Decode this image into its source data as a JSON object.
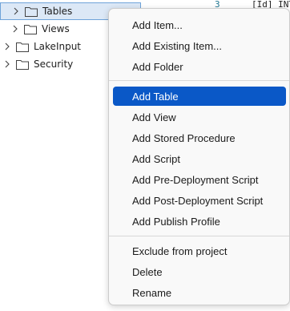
{
  "tree": {
    "items": [
      {
        "label": "Tables",
        "icon": "folder-icon",
        "expand": "chevron-right-icon"
      },
      {
        "label": "Views",
        "icon": "folder-icon",
        "expand": "chevron-right-icon"
      },
      {
        "label": "LakeInput",
        "icon": "folder-icon",
        "expand": "chevron-right-icon"
      },
      {
        "label": "Security",
        "icon": "folder-icon",
        "expand": "chevron-right-icon"
      }
    ]
  },
  "editor": {
    "line_number": "3",
    "code": "[Id] INT"
  },
  "context_menu": {
    "items": [
      "Add Item...",
      "Add Existing Item...",
      "Add Folder",
      "Add Table",
      "Add View",
      "Add Stored Procedure",
      "Add Script",
      "Add Pre-Deployment Script",
      "Add Post-Deployment Script",
      "Add Publish Profile",
      "Exclude from project",
      "Delete",
      "Rename"
    ],
    "highlighted": "Add Table"
  },
  "colors": {
    "highlight": "#0a58c7",
    "selection": "#dce8f6",
    "selection_border": "#6fa3d9"
  }
}
